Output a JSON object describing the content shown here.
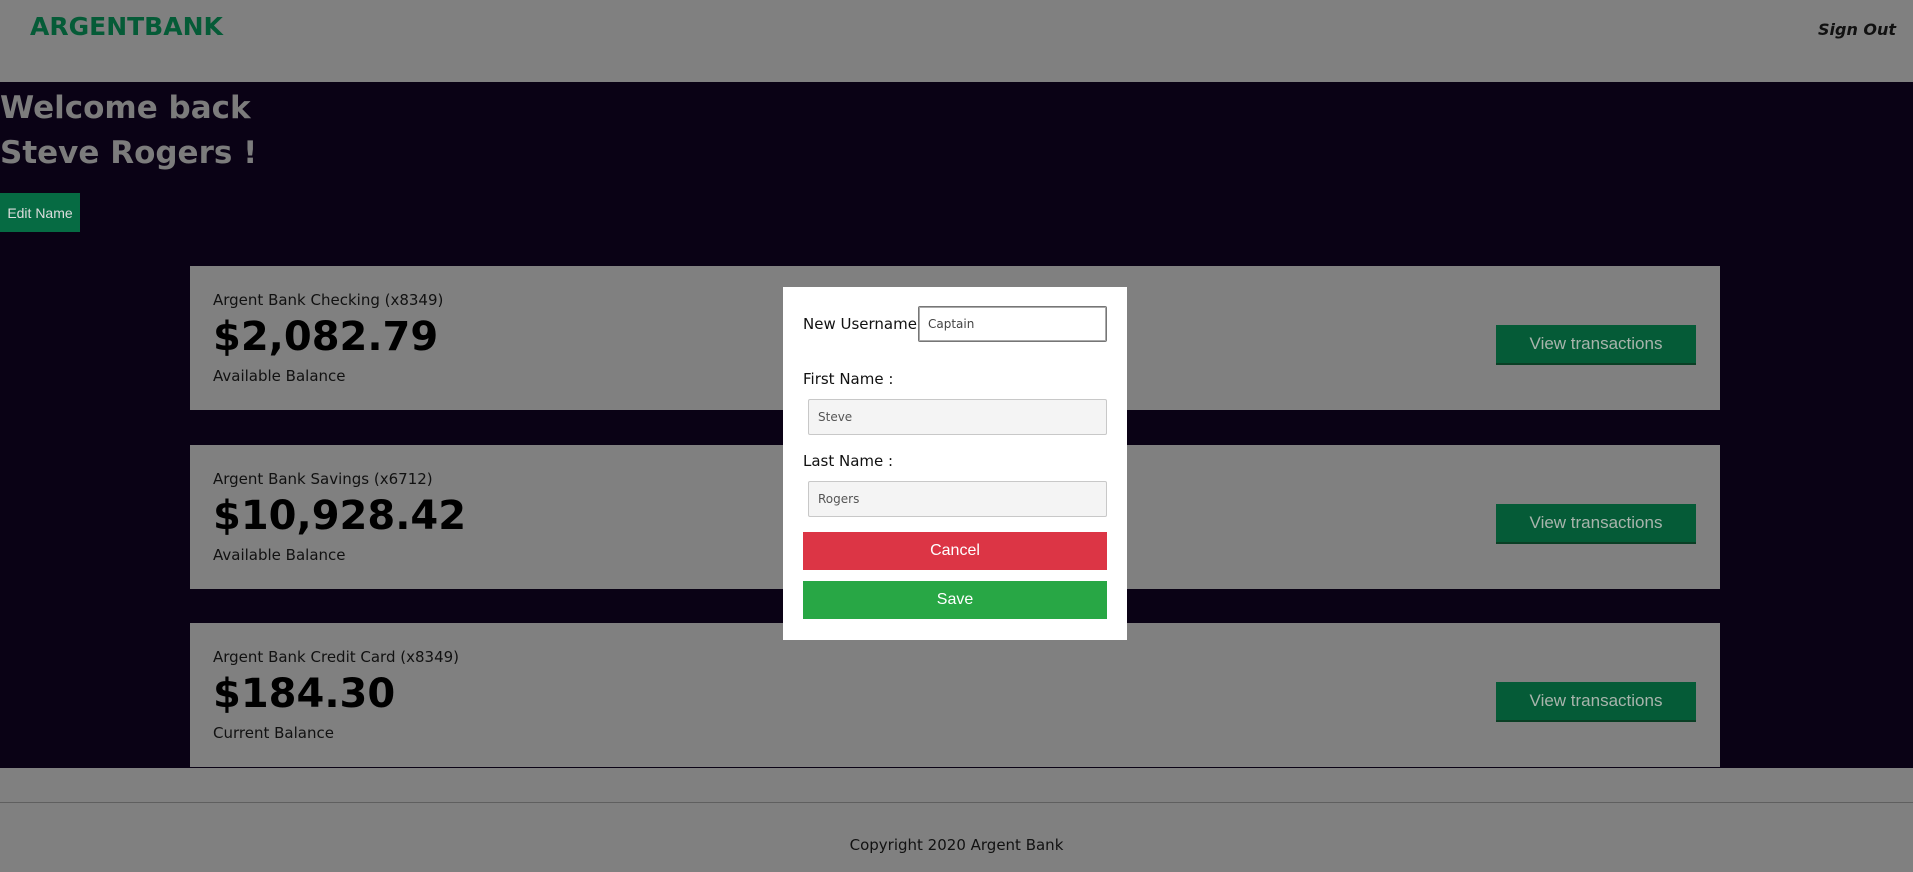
{
  "header": {
    "logo_text": "ARGENTBANK",
    "sign_out_label": "Sign Out"
  },
  "welcome": {
    "line1": "Welcome back",
    "line2": "Steve Rogers !",
    "edit_name_label": "Edit Name"
  },
  "accounts": [
    {
      "title": "Argent Bank Checking (x8349)",
      "amount": "$2,082.79",
      "description": "Available Balance",
      "button_label": "View transactions"
    },
    {
      "title": "Argent Bank Savings (x6712)",
      "amount": "$10,928.42",
      "description": "Available Balance",
      "button_label": "View transactions"
    },
    {
      "title": "Argent Bank Credit Card (x8349)",
      "amount": "$184.30",
      "description": "Current Balance",
      "button_label": "View transactions"
    }
  ],
  "footer": {
    "copyright": "Copyright 2020 Argent Bank"
  },
  "modal": {
    "username_label": "New Username:",
    "username_value": "Captain",
    "first_name_label": "First Name :",
    "first_name_value": "Steve",
    "last_name_label": "Last Name :",
    "last_name_value": "Rogers",
    "cancel_label": "Cancel",
    "save_label": "Save"
  },
  "colors": {
    "brand_green": "#00bc77",
    "main_background": "#12002b",
    "cancel_red": "#dc3545",
    "save_green": "#28a745"
  }
}
